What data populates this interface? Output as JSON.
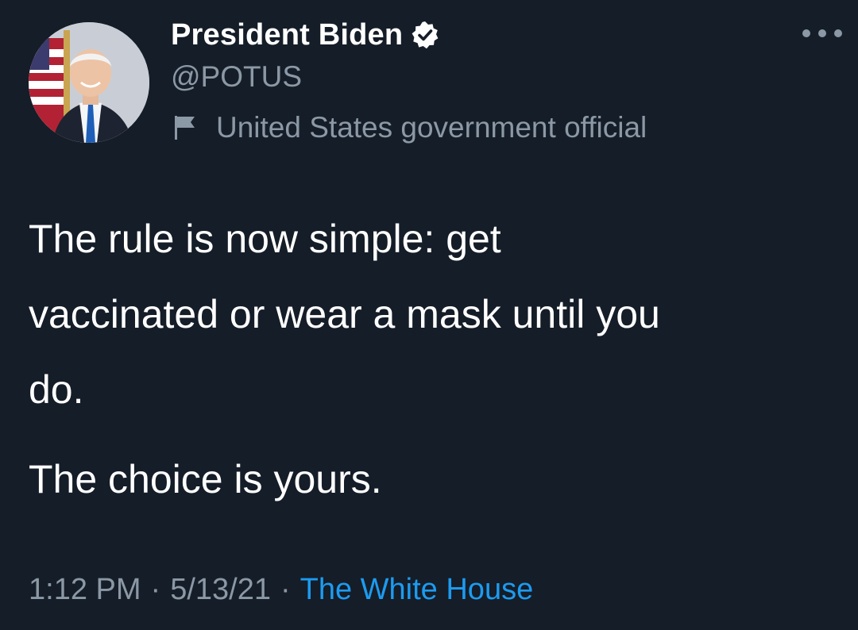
{
  "author": {
    "display_name": "President Biden",
    "handle": "@POTUS",
    "label": "United States government official",
    "verified": true
  },
  "tweet": {
    "paragraphs": [
      "The rule is now simple: get\nvaccinated or wear a mask until you\ndo.",
      "The choice is yours."
    ]
  },
  "meta": {
    "time": "1:12 PM",
    "separator": "·",
    "date": "5/13/21",
    "source": "The White House"
  },
  "colors": {
    "background": "#151d28",
    "secondary_text": "#8b98a5",
    "link": "#1d9bf0"
  },
  "icons": {
    "more": "more-horizontal-icon",
    "verified": "verified-badge-icon",
    "label": "flag-icon"
  }
}
